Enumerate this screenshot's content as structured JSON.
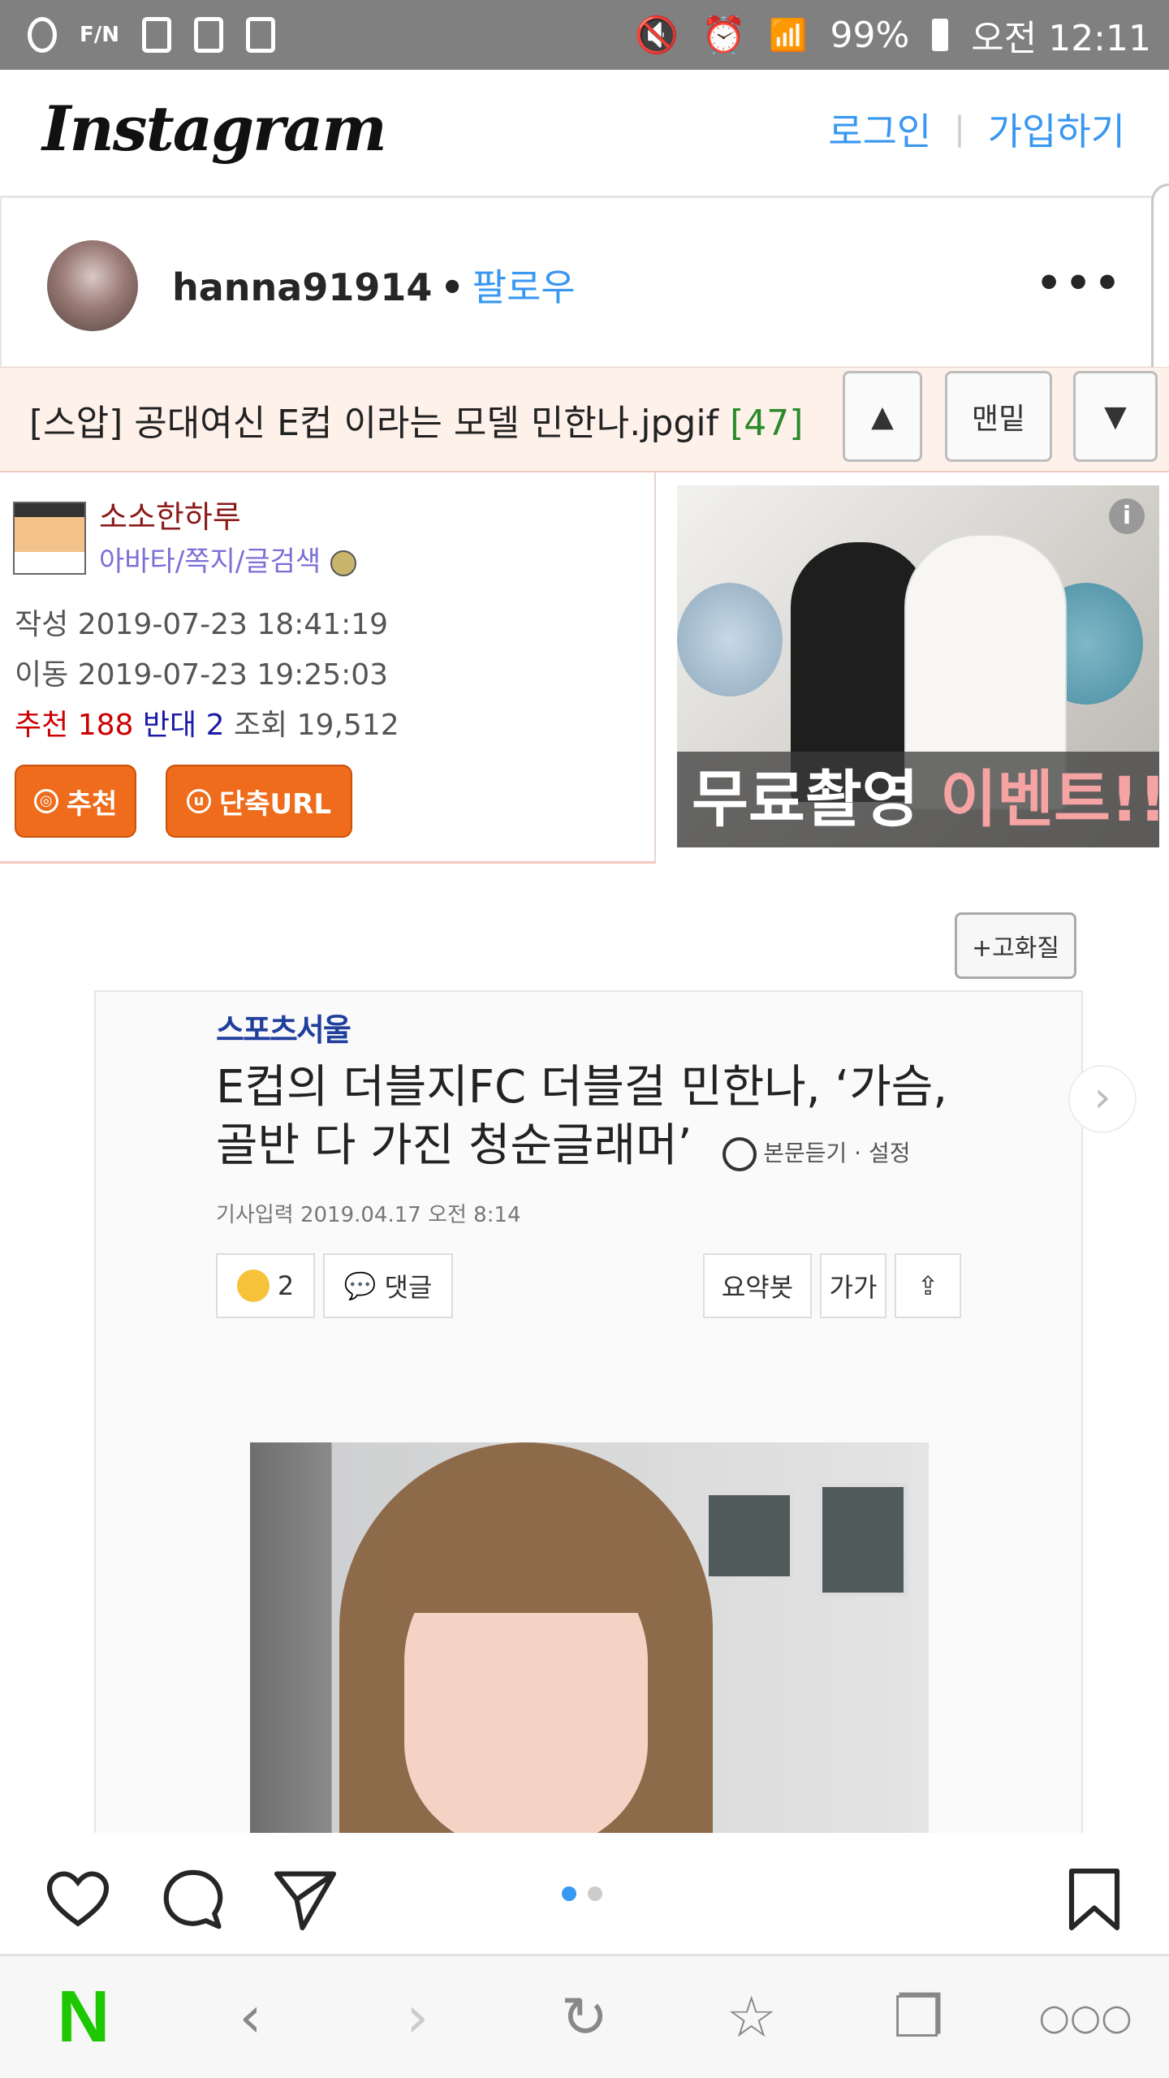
{
  "status_bar": {
    "battery": "99%",
    "time": "오전 12:11",
    "icon_label": "F/N"
  },
  "header": {
    "logo": "Instagram",
    "login_label": "로그인",
    "signup_label": "가입하기"
  },
  "post": {
    "username": "hanna91914",
    "follow_label": "팔로우"
  },
  "board": {
    "title": "[스압] 공대여신 E컵 이라는 모델 민한나.jpgif",
    "comment_count": "[47]",
    "up_label": "▲",
    "bottom_label": "맨밑",
    "down_label": "▼",
    "nickname": "소소한하루",
    "links": "아바타/쪽지/글검색",
    "written_label": "작성",
    "written_date": "2019-07-23 18:41:19",
    "moved_label": "이동",
    "moved_date": "2019-07-23 19:25:03",
    "recommend_label": "추천",
    "recommend_count": "188",
    "oppose_label": "반대",
    "oppose_count": "2",
    "views_label": "조회",
    "views_count": "19,512",
    "recommend_button": "추천",
    "shorturl_button": "단축URL",
    "ad_text_white": "무료촬영",
    "ad_text_pink": "이벤트!!",
    "hq_button": "+고화질"
  },
  "article": {
    "brand": "스포츠서울",
    "headline": "E컵의 더블지FC 더블걸 민한나, ‘가슴, 골반 다 가진 청순글래머’",
    "listen_label": "본문듣기 · 설정",
    "date": "기사입력  2019.04.17 오전 8:14",
    "reaction_count": "2",
    "comment_label": "댓글",
    "summary_label": "요약봇",
    "font_label": "가가"
  },
  "carousel": {
    "total": 2,
    "active": 1
  },
  "colors": {
    "instagram_blue": "#3897f0",
    "orange_button": "#ee6c1b",
    "naver_green": "#1ec800"
  }
}
